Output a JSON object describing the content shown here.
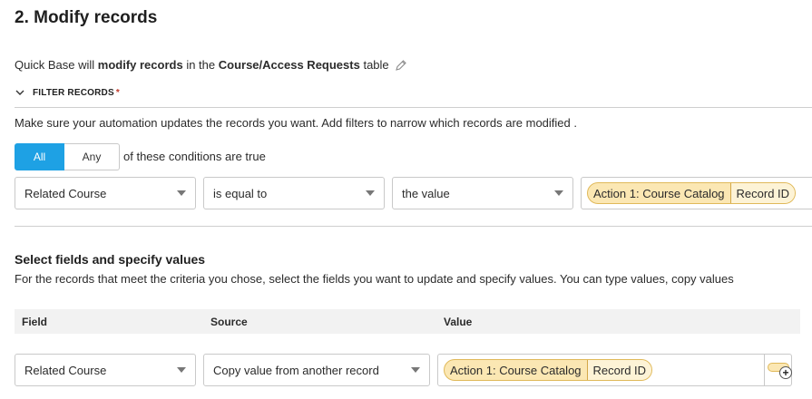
{
  "section": {
    "title": "2. Modify records"
  },
  "description": {
    "prefix": "Quick Base will",
    "action": "modify records",
    "middle": "in the",
    "table_name": "Course/Access Requests",
    "suffix": "table",
    "edit_icon": "pencil-icon"
  },
  "filter": {
    "header": "FILTER RECORDS",
    "required_mark": "*",
    "collapse_icon": "chevron-down-icon",
    "help_text": "Make sure your automation updates the records you want. Add filters to narrow which records are modified .",
    "match_all_label": "All",
    "match_any_label": "Any",
    "conditions_label": "of these conditions are true",
    "condition": {
      "field": "Related Course",
      "operator": "is equal to",
      "value_type": "the value",
      "token_source": "Action 1: Course Catalog",
      "token_field": "Record ID"
    }
  },
  "fields_section": {
    "title": "Select fields and specify values",
    "description": "For the records that meet the criteria you chose, select the fields you want to update and specify values. You can type values, copy values",
    "columns": [
      "Field",
      "Source",
      "Value"
    ],
    "rows": [
      {
        "field": "Related Course",
        "source": "Copy value from another record",
        "token_source": "Action 1: Course Catalog",
        "token_field": "Record ID"
      }
    ]
  },
  "colors": {
    "accent": "#1ea1e4",
    "token_bg": "#fbe7b3",
    "token_border": "#e0b95a"
  }
}
